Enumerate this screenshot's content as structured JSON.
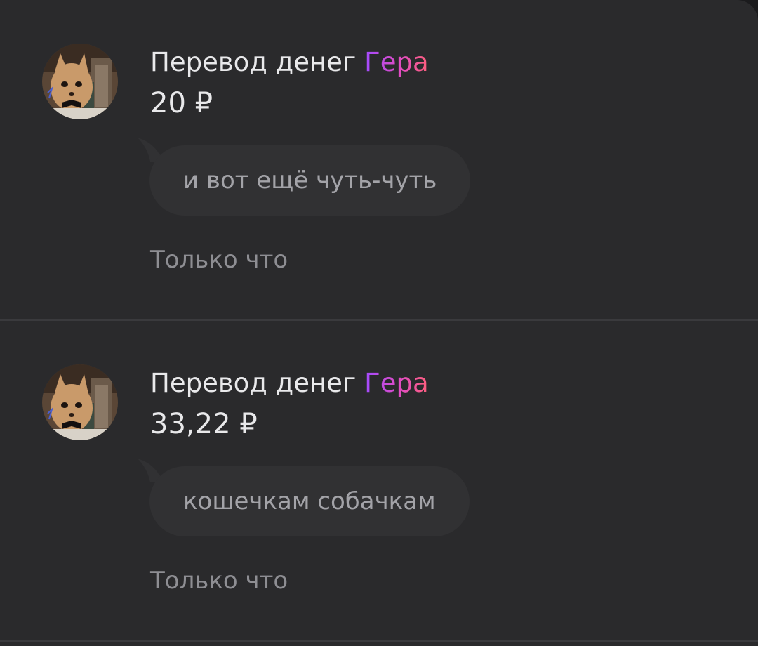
{
  "transfers": [
    {
      "title_prefix": "Перевод денег",
      "title_brand": "Гера",
      "amount": "20 ₽",
      "message": "и вот ещё чуть-чуть",
      "time": "Только что"
    },
    {
      "title_prefix": "Перевод денег",
      "title_brand": "Гера",
      "amount": "33,22 ₽",
      "message": "кошечкам собачкам",
      "time": "Только что"
    }
  ],
  "colors": {
    "background": "#2a2a2c",
    "bubble": "#313133",
    "brand_gradient_start": "#a24bff",
    "brand_gradient_end": "#ff5f7a",
    "primary_text": "#e9e9eb",
    "secondary_text": "#8e8e93"
  },
  "icons": {
    "avatar": "cat-photo-avatar"
  }
}
